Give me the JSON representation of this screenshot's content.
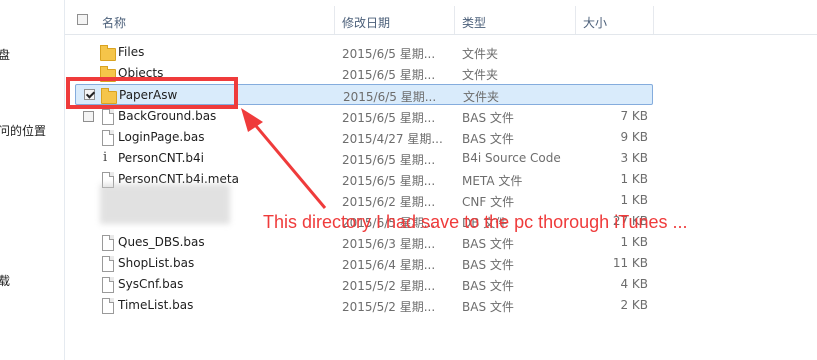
{
  "nav": {
    "items": [
      "盘",
      "问的位置",
      "载"
    ]
  },
  "columns": {
    "name": "名称",
    "modified": "修改日期",
    "type": "类型",
    "size": "大小"
  },
  "files": [
    {
      "name": "Files",
      "date": "2015/6/5 星期...",
      "type": "文件夹",
      "size": "",
      "icon": "folder-icon"
    },
    {
      "name": "Objects",
      "date": "2015/6/5 星期...",
      "type": "文件夹",
      "size": "",
      "icon": "folder-icon"
    },
    {
      "name": "PaperAsw",
      "date": "2015/6/5 星期...",
      "type": "文件夹",
      "size": "",
      "icon": "folder-icon",
      "selected": true,
      "checked": true
    },
    {
      "name": "BackGround.bas",
      "date": "2015/6/5 星期...",
      "type": "BAS 文件",
      "size": "7 KB",
      "icon": "file-icon"
    },
    {
      "name": "LoginPage.bas",
      "date": "2015/4/27 星期...",
      "type": "BAS 文件",
      "size": "9 KB",
      "icon": "file-icon"
    },
    {
      "name": "PersonCNT.b4i",
      "date": "2015/6/5 星期...",
      "type": "B4i Source Code",
      "size": "3 KB",
      "icon": "info-icon"
    },
    {
      "name": "PersonCNT.b4i.meta",
      "date": "2015/6/5 星期...",
      "type": "META 文件",
      "size": "1 KB",
      "icon": "file-icon"
    },
    {
      "name": "",
      "date": "2015/6/2 星期...",
      "type": "CNF 文件",
      "size": "1 KB",
      "icon": "blurred"
    },
    {
      "name": "",
      "date": "2015/6/5 星期...",
      "type": "DB 文件",
      "size": "27 KB",
      "icon": "blurred"
    },
    {
      "name": "Ques_DBS.bas",
      "date": "2015/6/3 星期...",
      "type": "BAS 文件",
      "size": "1 KB",
      "icon": "file-icon"
    },
    {
      "name": "ShopList.bas",
      "date": "2015/6/4 星期...",
      "type": "BAS 文件",
      "size": "11 KB",
      "icon": "file-icon"
    },
    {
      "name": "SysCnf.bas",
      "date": "2015/5/2 星期...",
      "type": "BAS 文件",
      "size": "4 KB",
      "icon": "file-icon"
    },
    {
      "name": "TimeList.bas",
      "date": "2015/5/2 星期...",
      "type": "BAS 文件",
      "size": "2 KB",
      "icon": "file-icon"
    }
  ],
  "annotation": {
    "text": "This directory I had save to the pc thorough iTunes ...",
    "color": "#ef3b3b"
  }
}
